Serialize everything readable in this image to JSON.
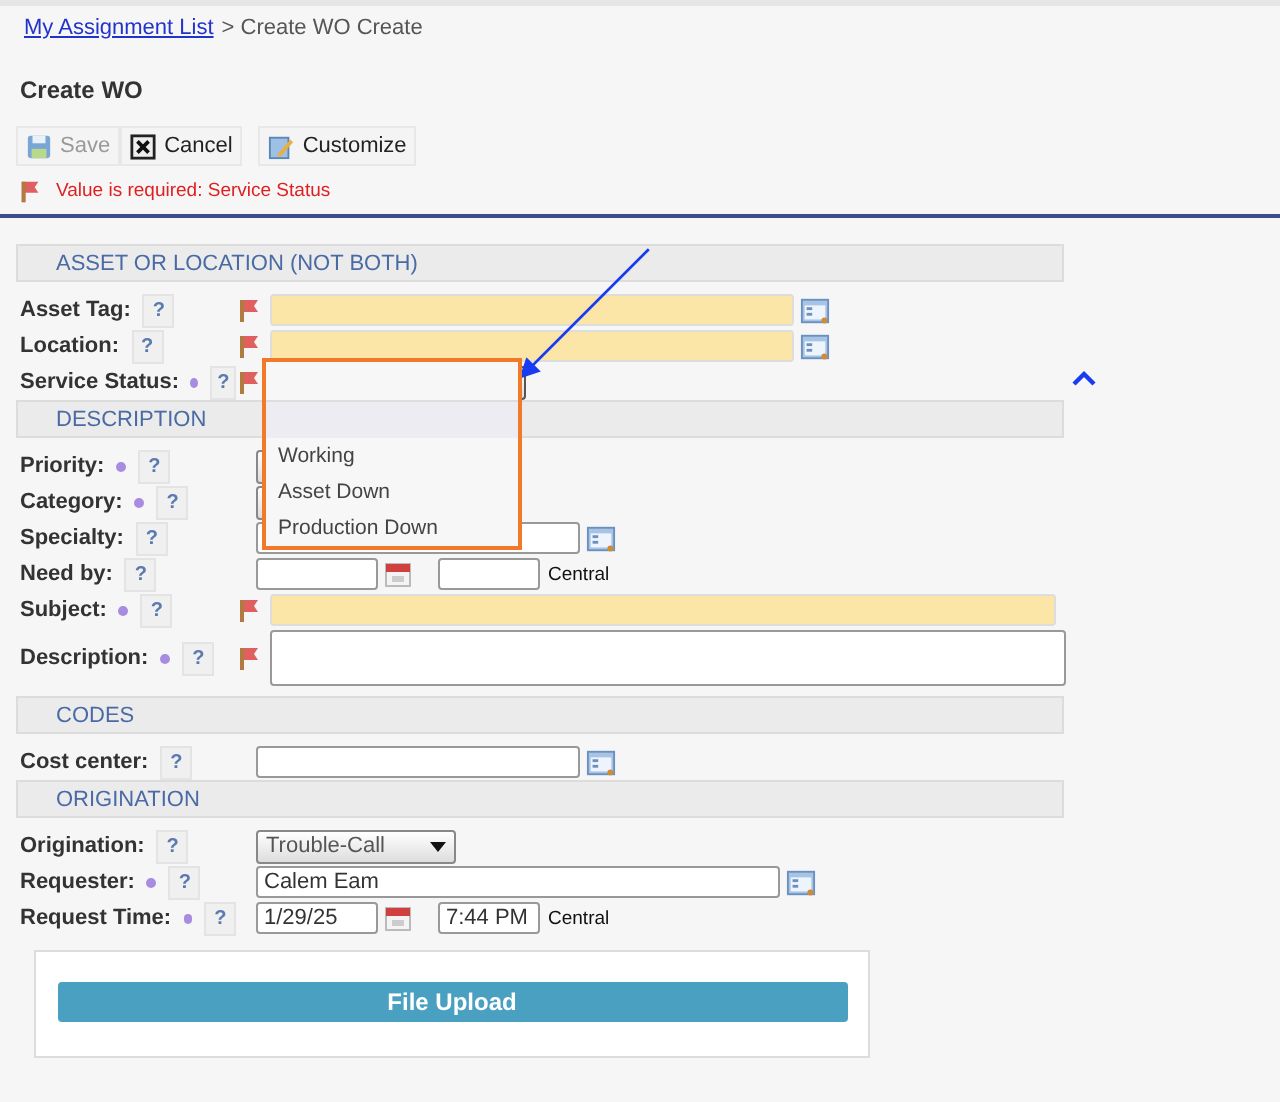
{
  "breadcrumb": {
    "link": "My Assignment List",
    "current": "> Create WO Create"
  },
  "title": "Create WO",
  "toolbar": [
    {
      "label": "Save",
      "disabled": true
    },
    {
      "label": "Cancel",
      "disabled": false
    },
    {
      "label": "Customize",
      "disabled": false
    }
  ],
  "error": "Value is required: Service Status",
  "sections": [
    {
      "title": "ASSET OR LOCATION (NOT BOTH)",
      "fields": [
        {
          "label": "Asset Tag:",
          "help": "?",
          "required": false,
          "flagged": true,
          "kind": "lookup",
          "highlighted": true
        },
        {
          "label": "Location:",
          "help": "?",
          "required": false,
          "flagged": true,
          "kind": "lookup",
          "highlighted": true
        },
        {
          "label": "Service Status:",
          "help": "?",
          "required": true,
          "flagged": true,
          "kind": "select",
          "expanded": true,
          "options": [
            {
              "label": "Working"
            },
            {
              "label": "Asset Down"
            },
            {
              "label": "Production Down"
            }
          ]
        }
      ]
    },
    {
      "title": "DESCRIPTION",
      "fields": [
        {
          "label": "Priority:",
          "help": "?",
          "required": true,
          "flagged": false,
          "kind": "select"
        },
        {
          "label": "Category:",
          "help": "?",
          "required": true,
          "flagged": false,
          "kind": "select"
        },
        {
          "label": "Specialty:",
          "help": "?",
          "required": false,
          "flagged": false,
          "kind": "short_lookup",
          "highlighted": false
        },
        {
          "label": "Need by:",
          "help": "?",
          "required": false,
          "flagged": false,
          "kind": "datetime",
          "zone": "Central"
        },
        {
          "label": "Subject:",
          "help": "?",
          "required": true,
          "flagged": true,
          "kind": "text",
          "highlighted": true
        },
        {
          "label": "Description:",
          "help": "?",
          "required": true,
          "flagged": true,
          "kind": "textarea"
        }
      ]
    },
    {
      "title": "CODES",
      "fields": [
        {
          "label": "Cost center:",
          "help": "?",
          "required": false,
          "flagged": false,
          "kind": "short_lookup",
          "highlighted": false
        }
      ]
    },
    {
      "title": "ORIGINATION",
      "fields": [
        {
          "label": "Origination:",
          "help": "?",
          "required": false,
          "flagged": false,
          "kind": "select",
          "value": "Trouble-Call"
        },
        {
          "label": "Requester:",
          "help": "?",
          "required": true,
          "flagged": false,
          "kind": "lookup",
          "highlighted": false,
          "value": "Calem Eam"
        },
        {
          "label": "Request Time:",
          "help": "?",
          "required": true,
          "flagged": false,
          "kind": "datetime",
          "date": "1/29/25",
          "time": "7:44 PM",
          "zone": "Central"
        }
      ]
    }
  ],
  "upload_button": "File Upload"
}
